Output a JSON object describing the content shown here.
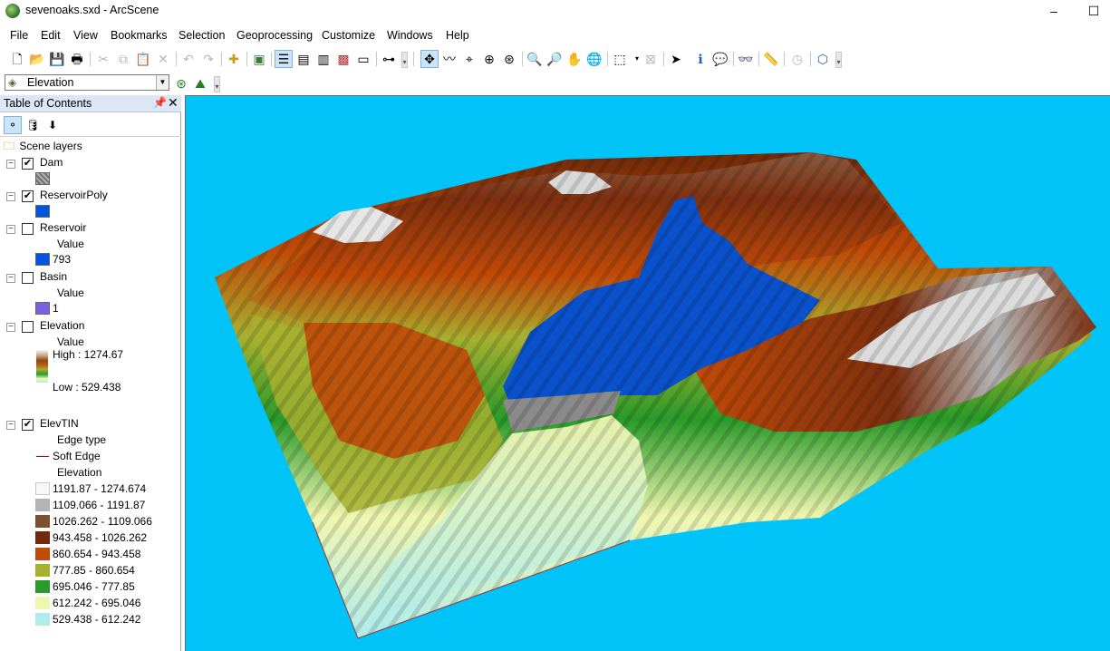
{
  "window": {
    "title": "sevenoaks.sxd - ArcScene"
  },
  "menu": [
    "File",
    "Edit",
    "View",
    "Bookmarks",
    "Selection",
    "Geoprocessing",
    "Customize",
    "Windows",
    "Help"
  ],
  "layer_dropdown": {
    "selected": "Elevation"
  },
  "toc": {
    "title": "Table of Contents",
    "root_label": "Scene layers",
    "layers": [
      {
        "name": "Dam",
        "checked": true
      },
      {
        "name": "ReservoirPoly",
        "checked": true,
        "swatch": "#0055e0"
      },
      {
        "name": "Reservoir",
        "checked": false,
        "field": "Value",
        "class_label": "793",
        "swatch": "#0055e0"
      },
      {
        "name": "Basin",
        "checked": false,
        "field": "Value",
        "class_label": "1",
        "swatch": "#7b5fe0"
      },
      {
        "name": "Elevation",
        "checked": false,
        "field": "Value",
        "high": "High : 1274.67",
        "low": "Low : 529.438"
      },
      {
        "name": "ElevTIN",
        "checked": true,
        "edge_heading": "Edge type",
        "edge_label": "Soft Edge",
        "elev_heading": "Elevation",
        "classes": [
          {
            "label": "1191.87 - 1274.674",
            "color": "#f8f8f8"
          },
          {
            "label": "1109.066 - 1191.87",
            "color": "#b4b4b4"
          },
          {
            "label": "1026.262 - 1109.066",
            "color": "#7d5030"
          },
          {
            "label": "943.458 - 1026.262",
            "color": "#6e2a0a"
          },
          {
            "label": "860.654 - 943.458",
            "color": "#c04a08"
          },
          {
            "label": "777.85 - 860.654",
            "color": "#a8b030"
          },
          {
            "label": "695.046 - 777.85",
            "color": "#2a9a2a"
          },
          {
            "label": "612.242 - 695.046",
            "color": "#f0f6b0"
          },
          {
            "label": "529.438 - 612.242",
            "color": "#b0ecec"
          }
        ]
      }
    ]
  },
  "scene": {
    "background": "#00c3f8"
  }
}
